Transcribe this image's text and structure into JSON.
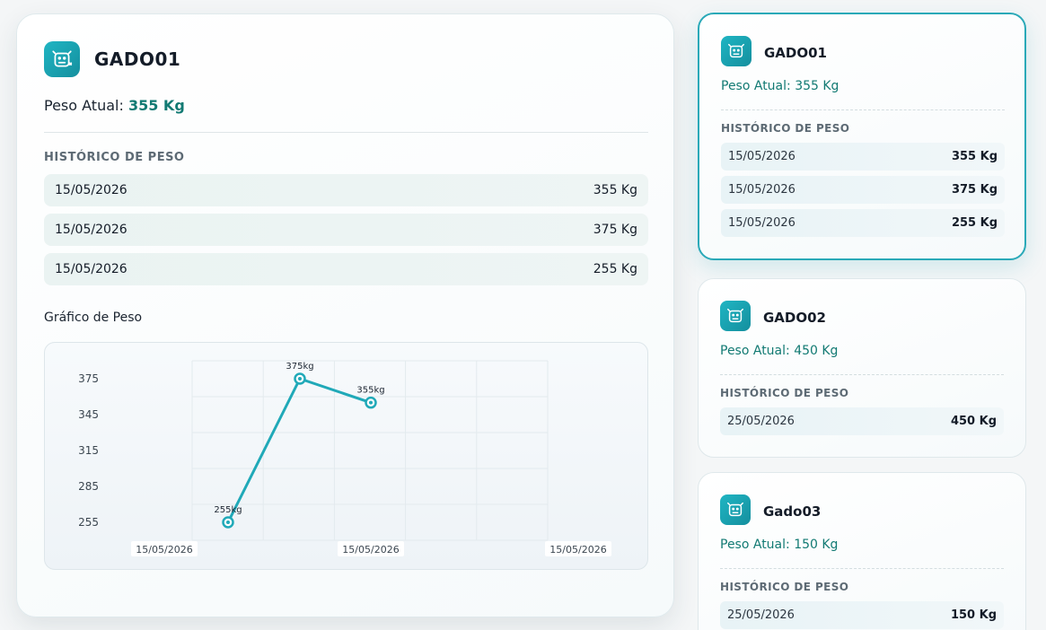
{
  "main": {
    "title": "GADO01",
    "peso_label": "Peso Atual:",
    "peso_value": "355 Kg",
    "historico_label": "HISTÓRICO DE PESO",
    "historico": [
      {
        "date": "15/05/2026",
        "weight": "355 Kg"
      },
      {
        "date": "15/05/2026",
        "weight": "375 Kg"
      },
      {
        "date": "15/05/2026",
        "weight": "255 Kg"
      }
    ],
    "chart_title": "Gráfico de Peso"
  },
  "chart_data": {
    "type": "line",
    "x": [
      "15/05/2026",
      "15/05/2026",
      "15/05/2026"
    ],
    "x_tick_labels": [
      "15/05/2026",
      "15/05/2026",
      "15/05/2026"
    ],
    "y_ticks": [
      255,
      285,
      315,
      345,
      375
    ],
    "series": [
      {
        "values": [
          255,
          375,
          355
        ],
        "point_labels": [
          "255kg",
          "375kg",
          "355kg"
        ],
        "color": "#20a9b8"
      }
    ],
    "ylim": [
      240,
      390
    ],
    "grid": true
  },
  "cards": [
    {
      "title": "GADO01",
      "peso": "Peso Atual: 355 Kg",
      "historico_label": "HISTÓRICO DE PESO",
      "historico": [
        {
          "date": "15/05/2026",
          "weight": "355 Kg"
        },
        {
          "date": "15/05/2026",
          "weight": "375 Kg"
        },
        {
          "date": "15/05/2026",
          "weight": "255 Kg"
        }
      ]
    },
    {
      "title": "GADO02",
      "peso": "Peso Atual: 450 Kg",
      "historico_label": "HISTÓRICO DE PESO",
      "historico": [
        {
          "date": "25/05/2026",
          "weight": "450 Kg"
        }
      ]
    },
    {
      "title": "Gado03",
      "peso": "Peso Atual: 150 Kg",
      "historico_label": "HISTÓRICO DE PESO",
      "historico": [
        {
          "date": "25/05/2026",
          "weight": "150 Kg"
        }
      ]
    }
  ],
  "colors": {
    "accent": "#20a9b8",
    "peso_value": "#127a73"
  },
  "icons": {
    "animal": "cow-icon"
  }
}
